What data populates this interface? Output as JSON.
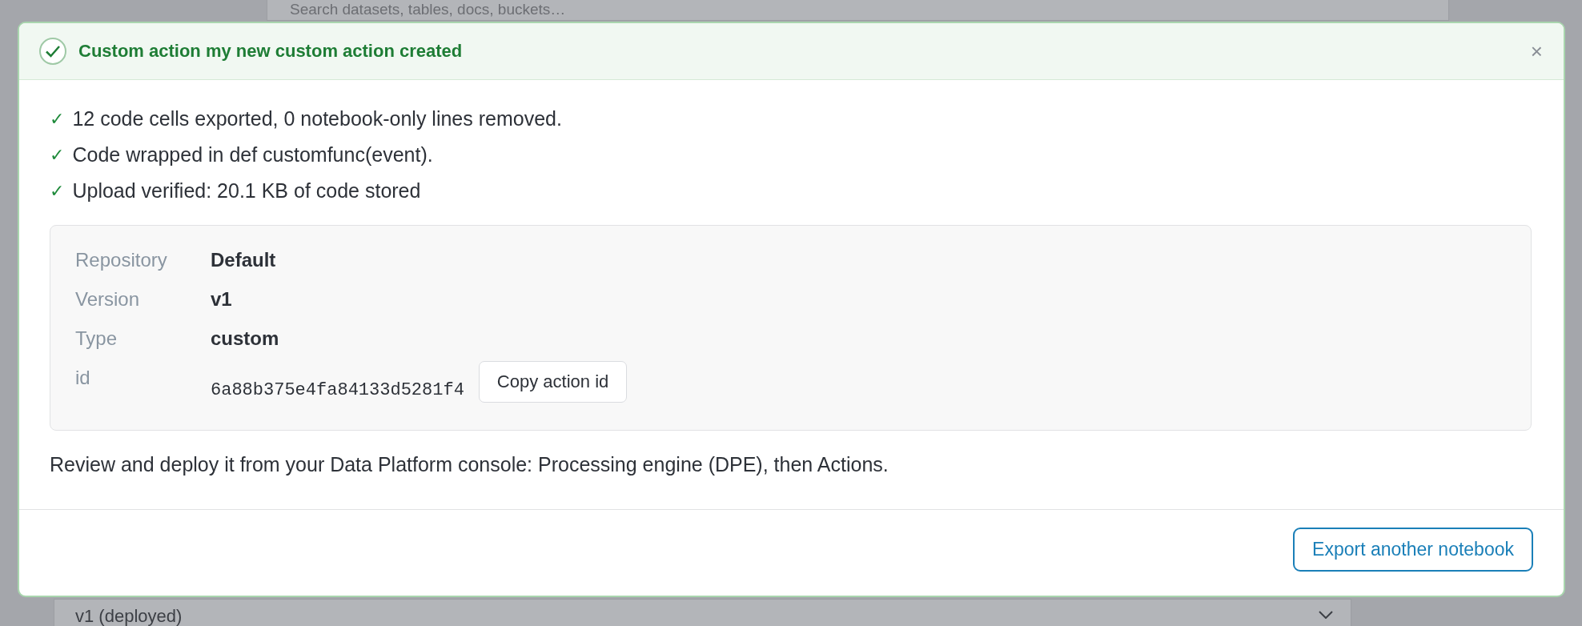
{
  "background": {
    "search": {
      "placeholder": "Search datasets, tables, docs, buckets…"
    },
    "version_select": {
      "value": "v1 (deployed)"
    }
  },
  "dialog": {
    "title": "Custom action my new custom action created",
    "close_label": "×",
    "checks": [
      {
        "mark": "✓",
        "text": "12 code cells exported, 0 notebook-only lines removed."
      },
      {
        "mark": "✓",
        "text": "Code wrapped in def customfunc(event)."
      },
      {
        "mark": "✓",
        "text": "Upload verified: 20.1 KB of code stored"
      }
    ],
    "details": [
      {
        "kind": "text",
        "label": "Repository",
        "value": "Default"
      },
      {
        "kind": "text",
        "label": "Version",
        "value": "v1"
      },
      {
        "kind": "text",
        "label": "Type",
        "value": "custom"
      },
      {
        "kind": "id",
        "label": "id",
        "value": "6a88b375e4fa84133d5281f4",
        "button": "Copy action id"
      }
    ],
    "note": "Review and deploy it from your Data Platform console: Processing engine (DPE), then Actions.",
    "footer_button": "Export another notebook"
  }
}
